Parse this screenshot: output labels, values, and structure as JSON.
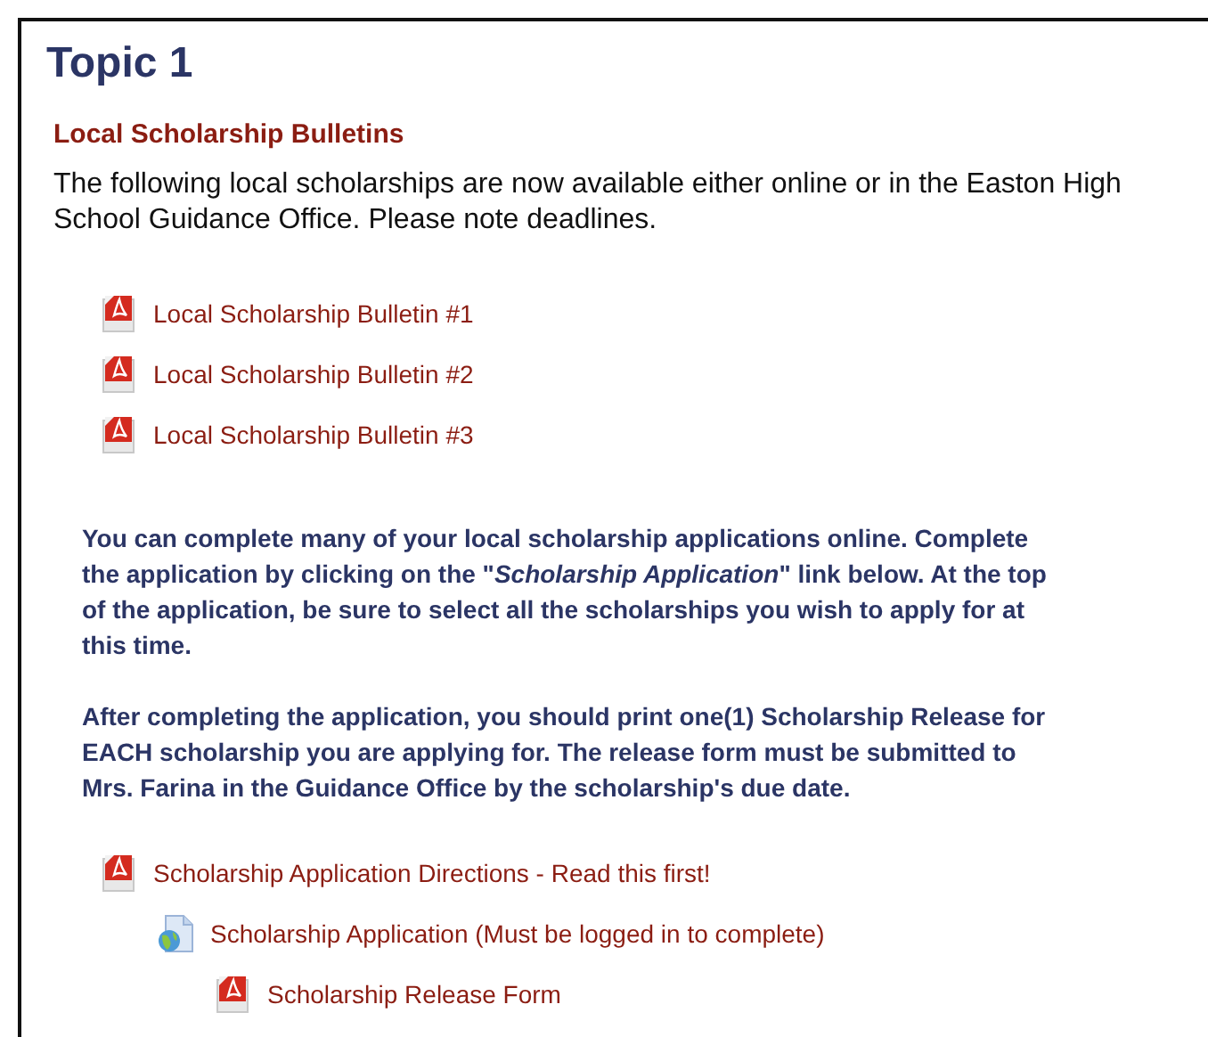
{
  "title": "Topic 1",
  "section_heading": "Local Scholarship Bulletins",
  "intro_lines": [
    "The following local scholarships are now available either online or in the Easton High",
    "School Guidance Office. Please note deadlines."
  ],
  "bulletins": [
    {
      "kind": "pdf",
      "label": "Local Scholarship Bulletin #1"
    },
    {
      "kind": "pdf",
      "label": "Local Scholarship Bulletin #2"
    },
    {
      "kind": "pdf",
      "label": "Local Scholarship Bulletin #3"
    }
  ],
  "notes": [
    {
      "lines": [
        "You can complete many of your local scholarship applications online. Complete",
        "the application by clicking on the \"*Scholarship Application*\" link below. At the top",
        "of the application, be sure to select all the scholarships you wish to apply for at",
        "this time."
      ]
    },
    {
      "lines": [
        "After completing the application, you should print one(1) Scholarship Release for",
        "EACH scholarship you are applying for. The release form must be submitted to",
        "Mrs. Farina in the Guidance Office by the scholarship's due date."
      ]
    }
  ],
  "resources": [
    {
      "kind": "pdf",
      "label": "Scholarship Application Directions - Read this first!",
      "children": [
        {
          "kind": "web",
          "label": "Scholarship Application (Must be logged in to complete)",
          "children": [
            {
              "kind": "pdf",
              "label": "Scholarship Release Form"
            }
          ]
        }
      ]
    }
  ]
}
